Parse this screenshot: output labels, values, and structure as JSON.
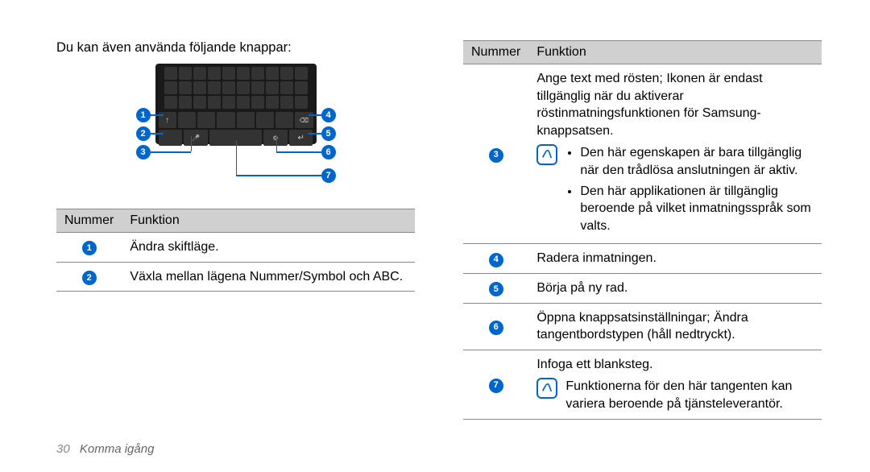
{
  "intro": "Du kan även använda följande knappar:",
  "left_table": {
    "header_num": "Nummer",
    "header_fn": "Funktion",
    "rows": [
      {
        "n": "1",
        "fn": "Ändra skiftläge."
      },
      {
        "n": "2",
        "fn": "Växla mellan lägena Nummer/Symbol och ABC."
      }
    ]
  },
  "right_table": {
    "header_num": "Nummer",
    "header_fn": "Funktion",
    "rows": [
      {
        "n": "3",
        "main": "Ange text med rösten; Ikonen är endast tillgänglig när du aktiverar röstinmatningsfunktionen för Samsung-knappsatsen.",
        "note_bullets": [
          "Den här egenskapen är bara tillgänglig när den trådlösa anslutningen är aktiv.",
          "Den här applikationen är tillgänglig beroende på vilket inmatningsspråk som valts."
        ]
      },
      {
        "n": "4",
        "fn": "Radera inmatningen."
      },
      {
        "n": "5",
        "fn": "Börja på ny rad."
      },
      {
        "n": "6",
        "fn": "Öppna knappsatsinställningar; Ändra tangentbordstypen (håll nedtryckt)."
      },
      {
        "n": "7",
        "main": "Infoga ett blanksteg.",
        "note_text": "Funktionerna för den här tangenten kan variera beroende på tjänsteleverantör."
      }
    ]
  },
  "callouts": {
    "c1": "1",
    "c2": "2",
    "c3": "3",
    "c4": "4",
    "c5": "5",
    "c6": "6",
    "c7": "7"
  },
  "footer": {
    "page": "30",
    "section": "Komma igång"
  }
}
